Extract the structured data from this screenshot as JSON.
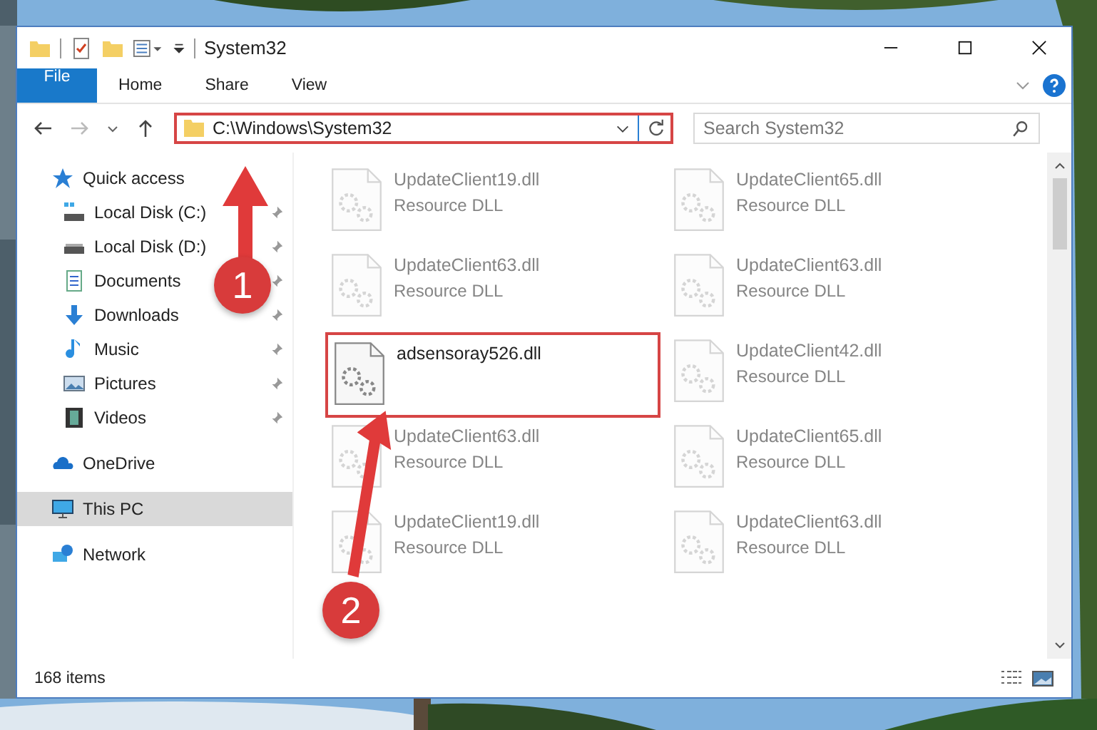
{
  "window": {
    "title": "System32"
  },
  "ribbon_tabs": [
    {
      "label": "File",
      "kind": "file"
    },
    {
      "label": "Home",
      "kind": "tab"
    },
    {
      "label": "Share",
      "kind": "tab"
    },
    {
      "label": "View",
      "kind": "tab"
    }
  ],
  "address": {
    "path": "C:\\Windows\\System32",
    "highlighted": true
  },
  "search": {
    "placeholder": "Search System32"
  },
  "sidebar": {
    "items": [
      {
        "label": "Quick access",
        "kind": "star",
        "selected": false,
        "children": [
          {
            "label": "Local Disk (C:)",
            "kind": "system-drive",
            "selected": false,
            "pinned": true
          },
          {
            "label": "Local Disk (D:)",
            "kind": "drive",
            "selected": false,
            "pinned": true
          },
          {
            "label": "Documents",
            "kind": "documents",
            "selected": false,
            "pinned": true
          },
          {
            "label": "Downloads",
            "kind": "downloads",
            "selected": false,
            "pinned": true
          },
          {
            "label": "Music",
            "kind": "music",
            "selected": false,
            "pinned": true
          },
          {
            "label": "Pictures",
            "kind": "pictures",
            "selected": false,
            "pinned": true
          },
          {
            "label": "Videos",
            "kind": "videos",
            "selected": false,
            "pinned": true
          }
        ]
      },
      {
        "label": "OneDrive",
        "kind": "cloud",
        "selected": false
      },
      {
        "label": "This PC",
        "kind": "computer",
        "selected": true
      },
      {
        "label": "Network",
        "kind": "network",
        "selected": false
      }
    ]
  },
  "files": [
    {
      "name": "UpdateClient19.dll",
      "type": "Resource DLL",
      "faded": true,
      "highlighted": false
    },
    {
      "name": "UpdateClient65.dll",
      "type": "Resource DLL",
      "faded": true,
      "highlighted": false
    },
    {
      "name": "UpdateClient63.dll",
      "type": "Resource DLL",
      "faded": true,
      "highlighted": false
    },
    {
      "name": "UpdateClient63.dll",
      "type": "Resource DLL",
      "faded": true,
      "highlighted": false
    },
    {
      "name": "adsensoray526.dll",
      "faded": false,
      "highlighted": true
    },
    {
      "name": "UpdateClient42.dll",
      "type": "Resource DLL",
      "faded": true,
      "highlighted": false
    },
    {
      "name": "UpdateClient63.dll",
      "type": "Resource DLL",
      "faded": true,
      "highlighted": false
    },
    {
      "name": "UpdateClient65.dll",
      "type": "Resource DLL",
      "faded": true,
      "highlighted": false
    },
    {
      "name": "UpdateClient19.dll",
      "type": "Resource DLL",
      "faded": true,
      "highlighted": false
    },
    {
      "name": "UpdateClient63.dll",
      "type": "Resource DLL",
      "faded": true,
      "highlighted": false
    }
  ],
  "status_bar": {
    "count": "168 items"
  },
  "annotations": [
    {
      "number": "1"
    },
    {
      "number": "2"
    }
  ]
}
